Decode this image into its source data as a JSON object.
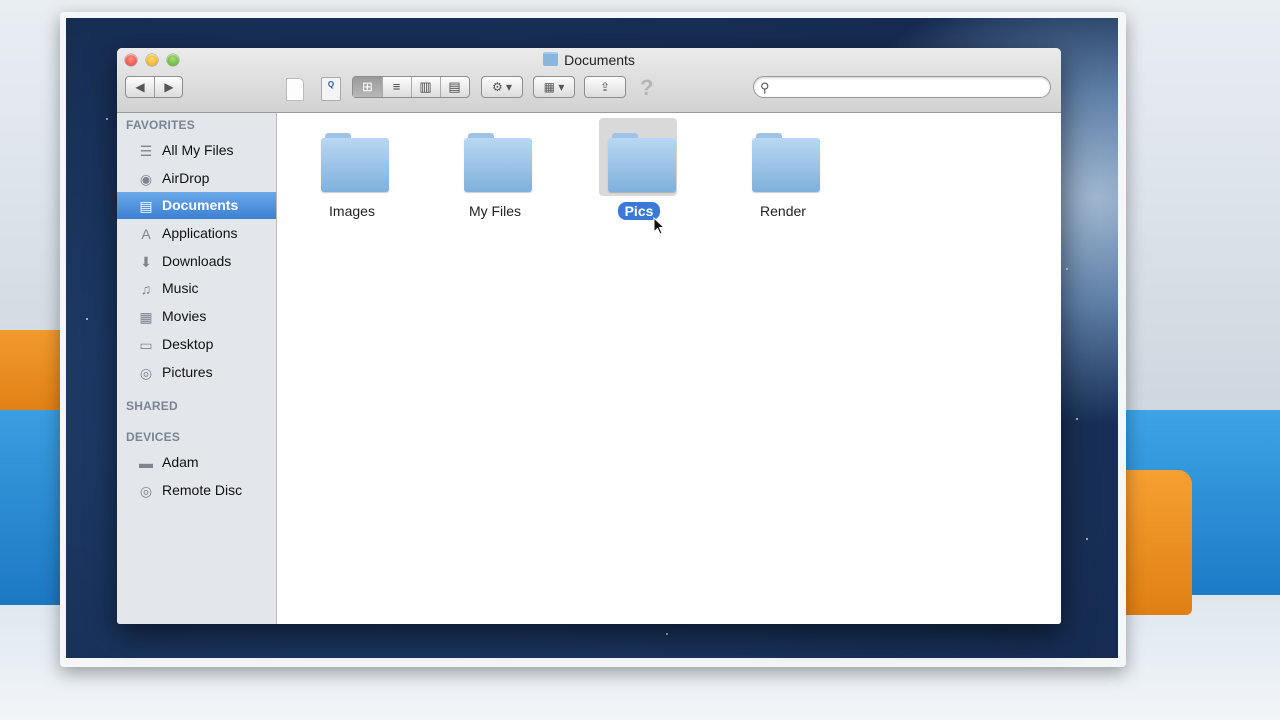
{
  "window": {
    "title": "Documents"
  },
  "toolbar": {
    "back_label": "◀",
    "forward_label": "▶",
    "quicklook_label": "Q",
    "view_icons": [
      "⊞",
      "≡",
      "▥",
      "▤"
    ],
    "action_label": "⚙ ▾",
    "arrange_label": "▦ ▾",
    "share_label": "⇪",
    "help_label": "?",
    "search_placeholder": ""
  },
  "sidebar": {
    "favorites_header": "FAVORITES",
    "shared_header": "SHARED",
    "devices_header": "DEVICES",
    "favorites": [
      {
        "label": "All My Files",
        "icon": "☰"
      },
      {
        "label": "AirDrop",
        "icon": "◉"
      },
      {
        "label": "Documents",
        "icon": "▤"
      },
      {
        "label": "Applications",
        "icon": "A"
      },
      {
        "label": "Downloads",
        "icon": "⬇"
      },
      {
        "label": "Music",
        "icon": "♫"
      },
      {
        "label": "Movies",
        "icon": "▦"
      },
      {
        "label": "Desktop",
        "icon": "▭"
      },
      {
        "label": "Pictures",
        "icon": "◎"
      }
    ],
    "devices": [
      {
        "label": "Adam",
        "icon": "▬"
      },
      {
        "label": "Remote Disc",
        "icon": "◎"
      }
    ],
    "selected": "Documents"
  },
  "folders": [
    {
      "name": "Images"
    },
    {
      "name": "My Files"
    },
    {
      "name": "Pics"
    },
    {
      "name": "Render"
    }
  ],
  "selected_folder": "Pics",
  "colors": {
    "selection": "#3b80d4",
    "folder": "#8fbbe3",
    "sidebar_bg": "#e3e7ec"
  }
}
